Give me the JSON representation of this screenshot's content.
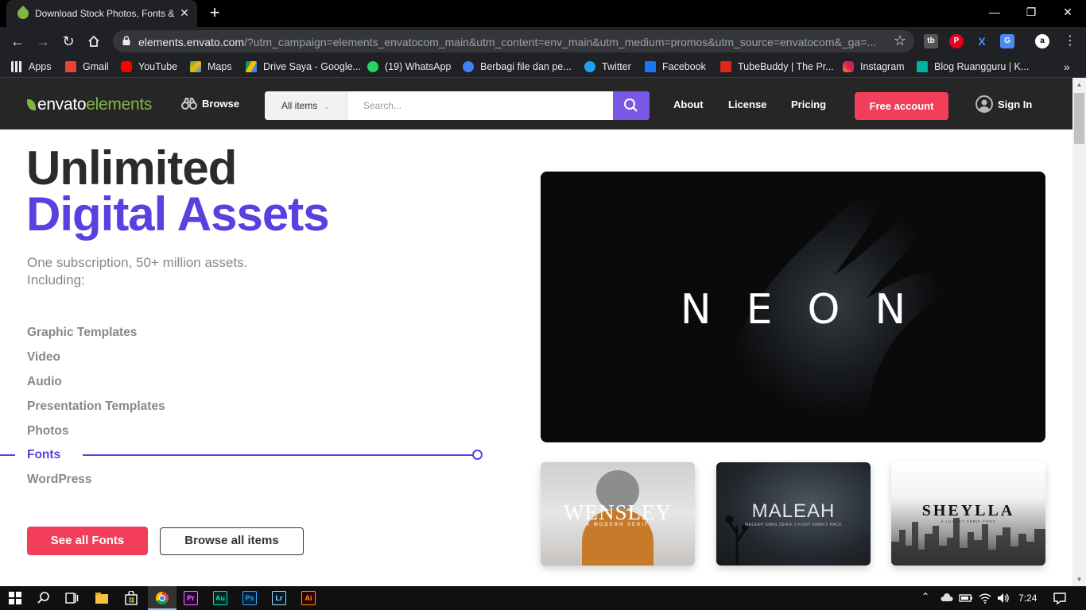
{
  "browser": {
    "tab_title": "Download Stock Photos, Fonts & ...",
    "url_host": "elements.envato.com",
    "url_rest": "/?utm_campaign=elements_envatocom_main&utm_content=env_main&utm_medium=promos&utm_source=envatocom&_ga=...",
    "bookmarks": [
      {
        "label": "Apps",
        "color": "#4285f4"
      },
      {
        "label": "Gmail",
        "color": "#ea4335"
      },
      {
        "label": "YouTube",
        "color": "#ff0000"
      },
      {
        "label": "Maps",
        "color": "#34a853"
      },
      {
        "label": "Drive Saya - Google...",
        "color": "#fbbc04"
      },
      {
        "label": "(19) WhatsApp",
        "color": "#25d366"
      },
      {
        "label": "Berbagi file dan pe...",
        "color": "#3b82f6"
      },
      {
        "label": "Twitter",
        "color": "#1da1f2"
      },
      {
        "label": "Facebook",
        "color": "#1877f2"
      },
      {
        "label": "TubeBuddy | The Pr...",
        "color": "#e1251b"
      },
      {
        "label": "Instagram",
        "color": "#d6249f"
      },
      {
        "label": "Blog Ruangguru | K...",
        "color": "#00b3a4"
      }
    ],
    "more_bookmarks": "»"
  },
  "header": {
    "logo_envato": "envato",
    "logo_elements": "elements",
    "browse_label": "Browse",
    "category_select": "All items",
    "search_placeholder": "Search...",
    "nav": [
      "About",
      "License",
      "Pricing"
    ],
    "free_account": "Free account",
    "sign_in": "Sign In"
  },
  "hero": {
    "title_line1": "Unlimited",
    "title_line2": "Digital Assets",
    "subtitle_line1": "One subscription, 50+ million assets.",
    "subtitle_line2": "Including:",
    "categories": [
      "Graphic Templates",
      "Video",
      "Audio",
      "Presentation Templates",
      "Photos",
      "Fonts",
      "WordPress"
    ],
    "active_category": "Fonts",
    "see_all_button": "See all Fonts",
    "browse_all_button": "Browse all items"
  },
  "previews": {
    "main_title": "NEON",
    "thumb1_title": "WENSLEY",
    "thumb1_sub": "A MODERN SERIF",
    "thumb2_title": "MALEAH",
    "thumb2_sub": "MALEAH SANS SERIF 3 FONT FAMILY PACK",
    "thumb3_title": "SHEYLLA",
    "thumb3_sub": "A LUXURY SERIF FONT"
  },
  "taskbar": {
    "apps": [
      {
        "label": "Pr",
        "fg": "#e77cff",
        "bg": "#2a0033"
      },
      {
        "label": "Au",
        "fg": "#00e4bb",
        "bg": "#00261e"
      },
      {
        "label": "Ps",
        "fg": "#31a8ff",
        "bg": "#001e36"
      },
      {
        "label": "Lr",
        "fg": "#add5ec",
        "bg": "#001a26"
      },
      {
        "label": "Ai",
        "fg": "#ff9a00",
        "bg": "#330000"
      }
    ],
    "clock": "7:24"
  },
  "colors": {
    "accent_purple": "#5b3fe0",
    "accent_red": "#f23e5a",
    "envato_green": "#82b541"
  }
}
